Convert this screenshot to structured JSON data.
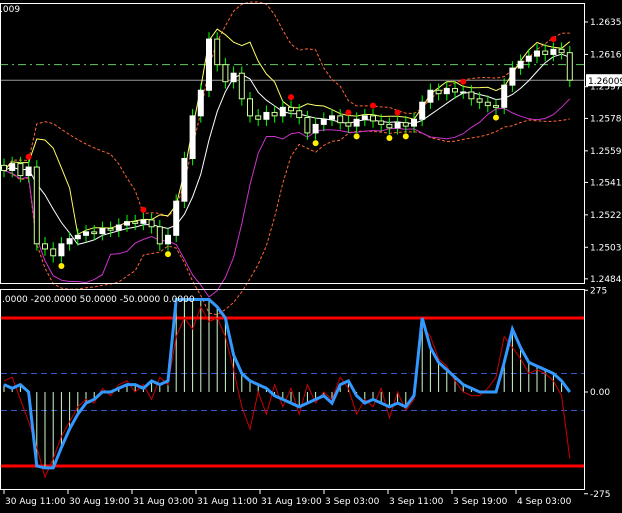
{
  "chart_data": [
    {
      "type": "candlestick",
      "title": "",
      "symbol_fragment": ".009",
      "ylim": [
        1.24845,
        1.2635
      ],
      "y_ticks": [
        "1.26350",
        "1.26160",
        "1.25971",
        "1.25785",
        "1.25595",
        "1.25410",
        "1.25220",
        "1.25030",
        "1.24845"
      ],
      "current_price": "1.26009",
      "dash_line_price": 1.261,
      "closes": [
        1.2548,
        1.2552,
        1.2545,
        1.255,
        1.2505,
        1.2502,
        1.2498,
        1.2505,
        1.2508,
        1.251,
        1.2512,
        1.2511,
        1.2514,
        1.2513,
        1.2516,
        1.2518,
        1.2517,
        1.2519,
        1.2515,
        1.2505,
        1.251,
        1.253,
        1.2555,
        1.258,
        1.2595,
        1.2625,
        1.261,
        1.26,
        1.2605,
        1.259,
        1.258,
        1.2578,
        1.2582,
        1.258,
        1.2585,
        1.2583,
        1.2579,
        1.257,
        1.2575,
        1.2578,
        1.258,
        1.2576,
        1.2574,
        1.2578,
        1.258,
        1.2577,
        1.2575,
        1.2573,
        1.2576,
        1.2574,
        1.2578,
        1.2588,
        1.2595,
        1.2593,
        1.2596,
        1.2594,
        1.2594,
        1.259,
        1.2588,
        1.2586,
        1.2585,
        1.2598,
        1.2608,
        1.2612,
        1.2615,
        1.2618,
        1.2616,
        1.2619,
        1.2617,
        1.26009
      ],
      "red_dots_at_bars": [
        3,
        17,
        35,
        42,
        45,
        48,
        56,
        67
      ],
      "yellow_dots_at_bars": [
        7,
        20,
        38,
        43,
        47,
        49,
        60
      ],
      "colors": {
        "bull": "#ffffff",
        "bear": "#ccff99",
        "wick": "#00ff00",
        "ma_fast": "#ffff66",
        "ma_slow": "#ffffff",
        "lower": "#cc33cc",
        "bands": "#ff6633",
        "dash": "#66cc66",
        "red_dot": "#ff0000",
        "yellow_dot": "#ffee00"
      }
    },
    {
      "type": "line",
      "header": ".0000 -200.0000 50.0000 -50.0000 0.0000",
      "ylim": [
        -275,
        275
      ],
      "y_ticks": [
        "275",
        "0.00",
        "-275"
      ],
      "levels": [
        200,
        -200,
        50,
        -50,
        0
      ],
      "series": [
        {
          "name": "main",
          "color": "#3399ff",
          "values": [
            20,
            10,
            20,
            0,
            -200,
            -205,
            -205,
            -150,
            -100,
            -60,
            -30,
            -20,
            0,
            0,
            10,
            20,
            20,
            10,
            30,
            20,
            30,
            250,
            250,
            250,
            250,
            250,
            230,
            200,
            100,
            50,
            30,
            20,
            10,
            -10,
            -20,
            -30,
            -40,
            -30,
            -20,
            -10,
            -30,
            20,
            30,
            -10,
            -30,
            -20,
            -30,
            -40,
            -30,
            -40,
            -10,
            200,
            120,
            80,
            60,
            40,
            20,
            10,
            0,
            0,
            0,
            80,
            170,
            120,
            80,
            70,
            60,
            50,
            30,
            0
          ]
        },
        {
          "name": "signal",
          "color": "#cc0000",
          "values": [
            30,
            40,
            -20,
            -80,
            -150,
            -230,
            -180,
            -120,
            -80,
            -40,
            -20,
            -30,
            10,
            -10,
            20,
            30,
            0,
            20,
            -20,
            40,
            20,
            150,
            200,
            170,
            230,
            190,
            200,
            150,
            60,
            -40,
            -100,
            0,
            -60,
            20,
            -40,
            10,
            -60,
            20,
            -30,
            0,
            -20,
            40,
            10,
            -60,
            -20,
            -40,
            10,
            -70,
            0,
            -50,
            -20,
            180,
            150,
            90,
            70,
            30,
            0,
            -10,
            -10,
            10,
            40,
            150,
            120,
            90,
            50,
            60,
            50,
            30,
            -10,
            -180
          ]
        }
      ]
    }
  ],
  "x_ticks": [
    "30 Aug 11:00",
    "30 Aug 19:00",
    "31 Aug 03:00",
    "31 Aug 11:00",
    "31 Aug 19:00",
    "3 Sep 03:00",
    "3 Sep 11:00",
    "3 Sep 19:00",
    "4 Sep 03:00"
  ]
}
